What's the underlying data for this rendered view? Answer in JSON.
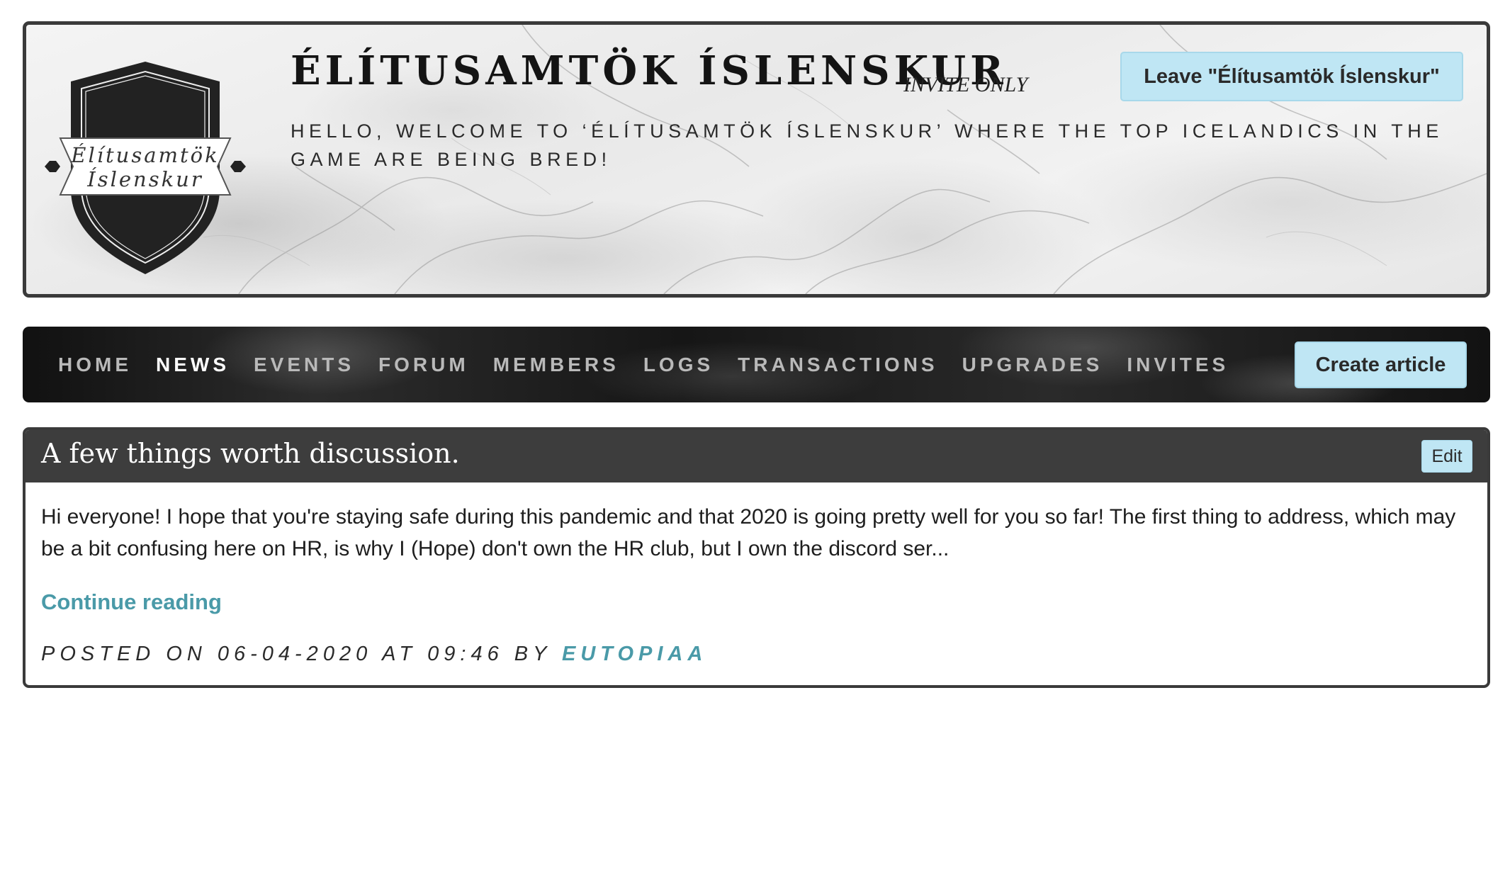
{
  "club": {
    "name": "ÉLÍTUSAMTÖK ÍSLENSKUR",
    "badge": "INVITE ONLY",
    "leave_label": "Leave \"Élítusamtök Íslenskur\"",
    "description": "HELLO, WELCOME TO ‘ÉLÍTUSAMTÖK ÍSLENSKUR’ WHERE THE TOP ICELANDICS IN THE GAME ARE BEING BRED!",
    "crest_line1": "Élítusamtök",
    "crest_line2": "Íslenskur"
  },
  "nav": {
    "items": [
      {
        "label": "HOME",
        "active": false
      },
      {
        "label": "NEWS",
        "active": true
      },
      {
        "label": "EVENTS",
        "active": false
      },
      {
        "label": "FORUM",
        "active": false
      },
      {
        "label": "MEMBERS",
        "active": false
      },
      {
        "label": "LOGS",
        "active": false
      },
      {
        "label": "TRANSACTIONS",
        "active": false
      },
      {
        "label": "UPGRADES",
        "active": false
      },
      {
        "label": "INVITES",
        "active": false
      }
    ],
    "create_label": "Create article"
  },
  "article": {
    "title": "A few things worth discussion.",
    "edit_label": "Edit",
    "excerpt": "Hi everyone! I hope that you're staying safe during this pandemic and that 2020 is going pretty well for you so far! The first thing to address, which may be a bit confusing here on HR, is why I (Hope) don't own the HR club, but I own the discord ser...",
    "continue_label": "Continue reading",
    "posted_prefix": "POSTED ON 06-04-2020 AT 09:46 BY",
    "author": "EUTOPIAA"
  },
  "colors": {
    "accent_button": "#bfe6f4",
    "link": "#4a9aa8",
    "dark_panel": "#3d3d3d"
  }
}
